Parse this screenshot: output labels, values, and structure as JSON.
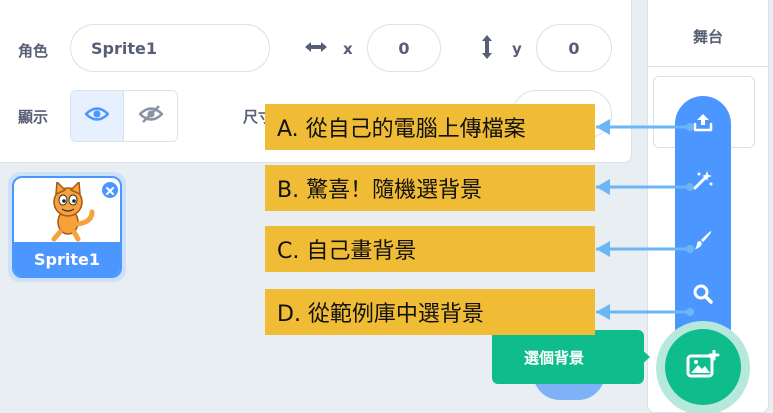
{
  "sprite_info": {
    "sprite_label": "角色",
    "sprite_name": "Sprite1",
    "x_label": "x",
    "x_value": "0",
    "y_label": "y",
    "y_value": "0",
    "show_label": "顯示",
    "size_label": "尺寸"
  },
  "sprite_list": {
    "items": [
      {
        "name": "Sprite1"
      }
    ]
  },
  "stage_panel": {
    "title": "舞台"
  },
  "backdrop_menu": {
    "tooltip": "選個背景",
    "icons": [
      "upload-icon",
      "surprise-icon",
      "paint-icon",
      "search-icon"
    ],
    "main_icon": "backdrop-icon"
  },
  "annotations": [
    "A. 從自己的電腦上傳檔案",
    "B. 驚喜！隨機選背景",
    "C. 自己畫背景",
    "D. 從範例庫中選背景"
  ],
  "colors": {
    "accent_blue": "#4c97ff",
    "green": "#0fbd8c",
    "callout": "#f0bb35",
    "arrow": "#6cb6f5"
  }
}
